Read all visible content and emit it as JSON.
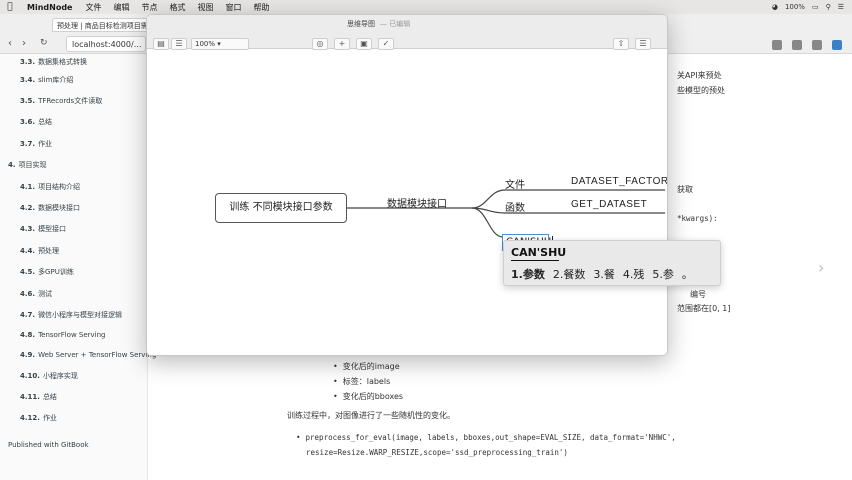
{
  "menubar": {
    "app": "MindNode",
    "items": [
      "文件",
      "编辑",
      "节点",
      "格式",
      "视图",
      "窗口",
      "帮助"
    ],
    "battery": "100%"
  },
  "browser": {
    "tab_title": "预处理 | 商品目标检测项目需…",
    "url": "localhost:4000/…",
    "zoom": "100%"
  },
  "sidebar": {
    "items": [
      {
        "num": "3.3.",
        "label": "数据集格式转换"
      },
      {
        "num": "3.4.",
        "label": "slim库介绍"
      },
      {
        "num": "3.5.",
        "label": "TFRecords文件读取"
      },
      {
        "num": "3.6.",
        "label": "总结"
      },
      {
        "num": "3.7.",
        "label": "作业"
      },
      {
        "num": "4.",
        "label": "项目实现"
      },
      {
        "num": "4.1.",
        "label": "项目结构介绍"
      },
      {
        "num": "4.2.",
        "label": "数据模块接口"
      },
      {
        "num": "4.3.",
        "label": "模型接口"
      },
      {
        "num": "4.4.",
        "label": "预处理"
      },
      {
        "num": "4.5.",
        "label": "多GPU训练"
      },
      {
        "num": "4.6.",
        "label": "测试"
      },
      {
        "num": "4.7.",
        "label": "微信小程序与模型对接逻辑"
      },
      {
        "num": "4.8.",
        "label": "TensorFlow Serving"
      },
      {
        "num": "4.9.",
        "label": "Web Server + TensorFlow Serving"
      },
      {
        "num": "4.10.",
        "label": "小程序实现"
      },
      {
        "num": "4.11.",
        "label": "总结"
      },
      {
        "num": "4.12.",
        "label": "作业"
      }
    ],
    "published": "Published with GitBook"
  },
  "page": {
    "frag_api": "关API来预处",
    "frag_model": "些模型的预处",
    "frag_get": "获取",
    "frag_kwargs": "*kwargs):",
    "frag_num": "编号",
    "frag_range": "范围都在[0, 1]",
    "bullet1": "变化后的image",
    "bullet2": "标签：labels",
    "bullet3": "变化后的bboxes",
    "para": "训练过程中，对图像进行了一些随机性的变化。",
    "code1": "preprocess_for_eval(image, labels, bboxes,out_shape=EVAL_SIZE, data_format='NHWC',",
    "code2": "resize=Resize.WARP_RESIZE,scope='ssd_preprocessing_train')"
  },
  "mindnode": {
    "title": "思维导图",
    "title_status": "— 已编辑",
    "zoom": "100%",
    "root": "训练 不同模块接口参数",
    "branch": "数据模块接口",
    "children": [
      {
        "label": "文件",
        "leaf": "DATASET_FACTORY"
      },
      {
        "label": "函数",
        "leaf": "GET_DATASET"
      }
    ],
    "editing_text": "CAN'SHU"
  },
  "ime": {
    "composition": "CAN'SHU",
    "candidates": [
      "1.参数",
      "2.餐数",
      "3.餐",
      "4.残",
      "5.参"
    ],
    "more": "。"
  }
}
